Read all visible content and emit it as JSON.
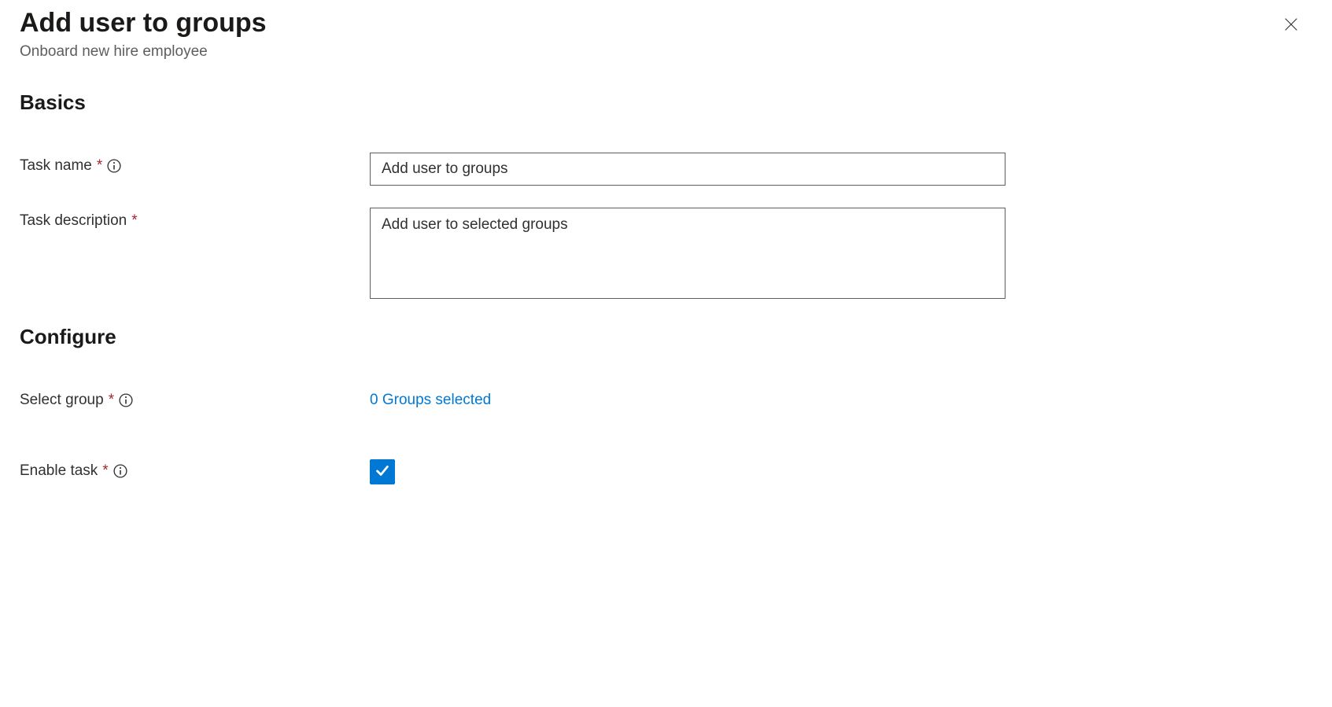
{
  "header": {
    "title": "Add user to groups",
    "subtitle": "Onboard new hire employee"
  },
  "sections": {
    "basics": {
      "heading": "Basics",
      "task_name_label": "Task name",
      "task_name_value": "Add user to groups",
      "task_description_label": "Task description",
      "task_description_value": "Add user to selected groups"
    },
    "configure": {
      "heading": "Configure",
      "select_group_label": "Select group",
      "select_group_link": "0 Groups selected",
      "enable_task_label": "Enable task",
      "enable_task_checked": true
    }
  }
}
